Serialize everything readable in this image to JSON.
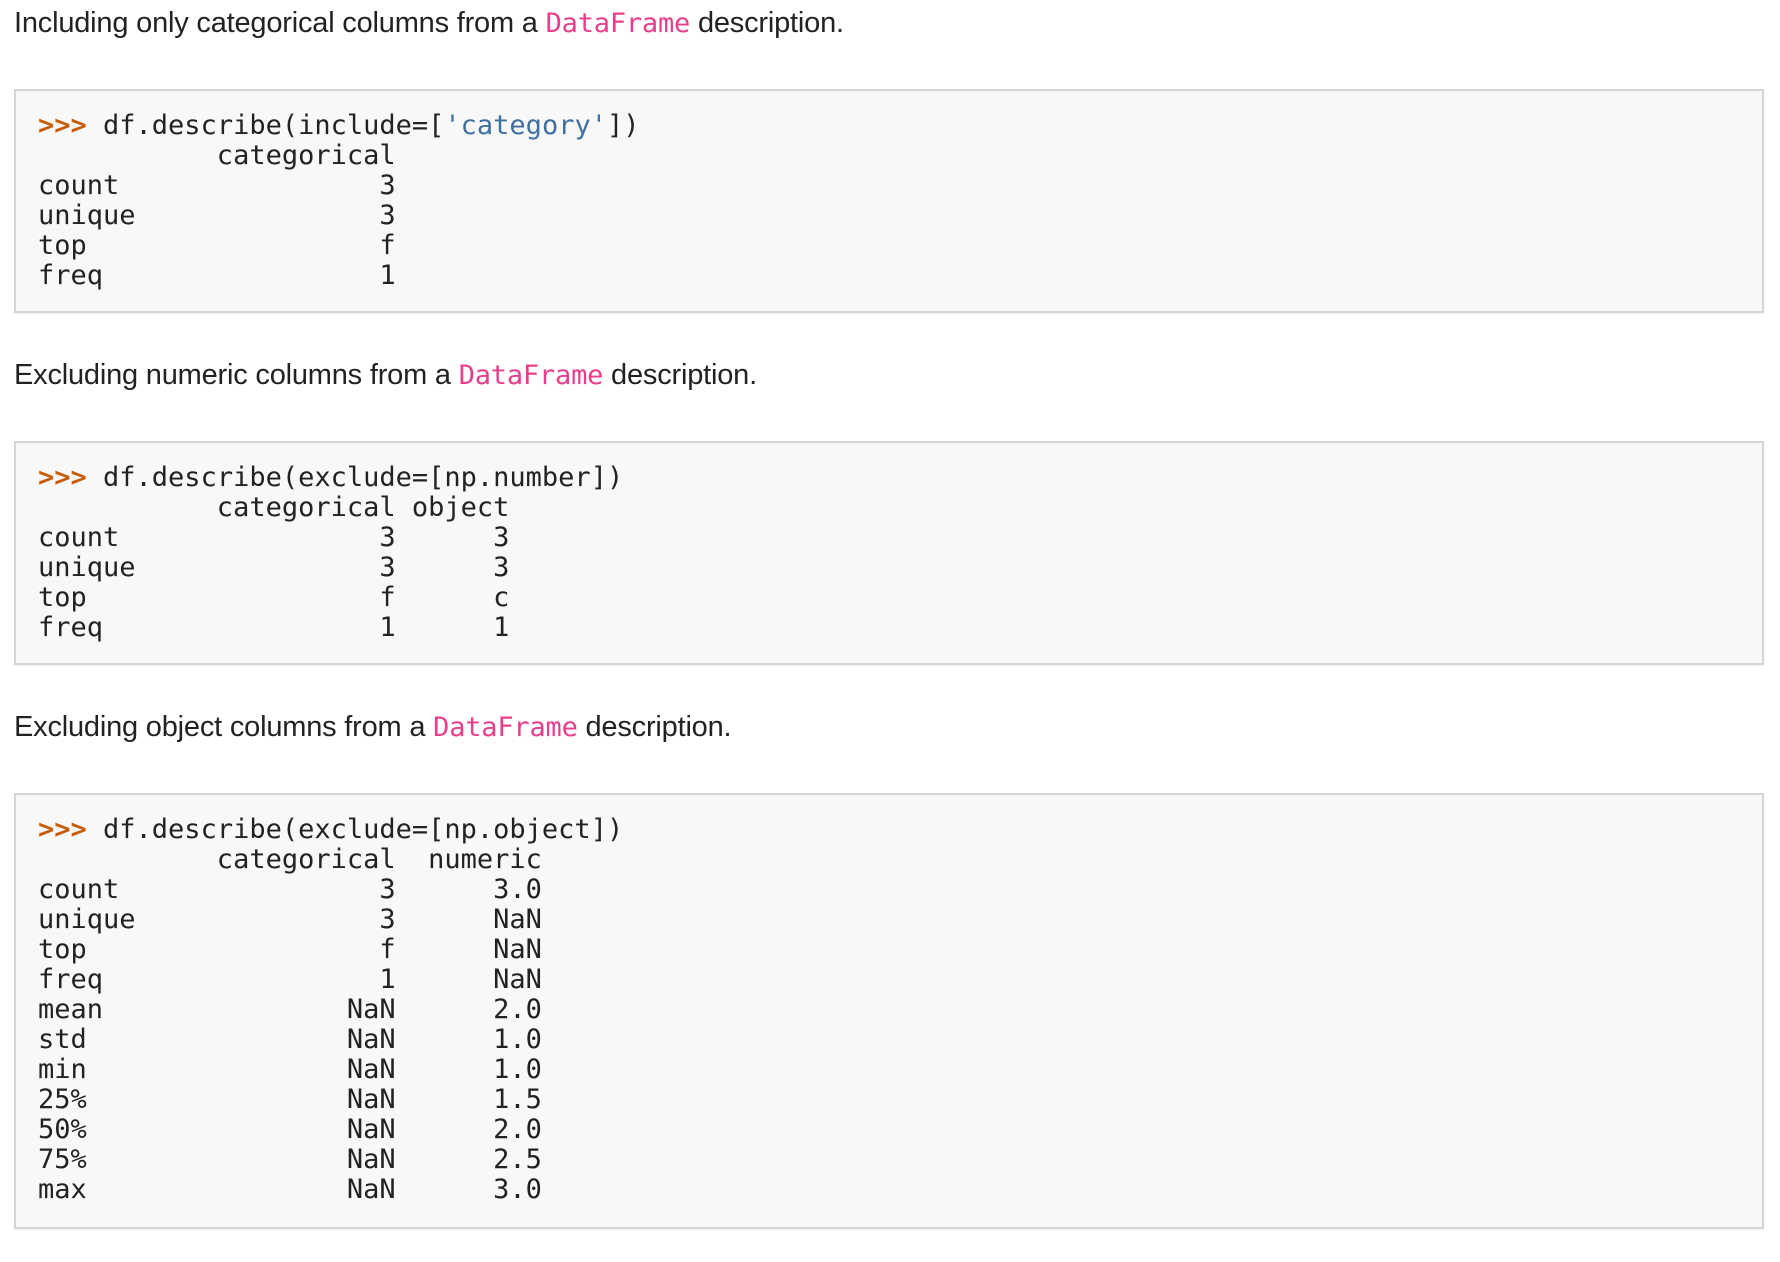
{
  "sections": [
    {
      "intro_before": "Including only categorical columns from a ",
      "intro_code": "DataFrame",
      "intro_after": " description.",
      "prompt": ">>> ",
      "command_before": "df.describe(include=[",
      "command_string": "'category'",
      "command_after": "])",
      "output": "           categorical\ncount                3\nunique               3\ntop                  f\nfreq                 1"
    },
    {
      "intro_before": "Excluding numeric columns from a ",
      "intro_code": "DataFrame",
      "intro_after": " description.",
      "prompt": ">>> ",
      "command": "df.describe(exclude=[np.number])",
      "output": "           categorical object\ncount                3      3\nunique               3      3\ntop                  f      c\nfreq                 1      1"
    },
    {
      "intro_before": "Excluding object columns from a ",
      "intro_code": "DataFrame",
      "intro_after": " description.",
      "prompt": ">>> ",
      "command": "df.describe(exclude=[np.object])",
      "output": "           categorical  numeric\ncount                3      3.0\nunique               3      NaN\ntop                  f      NaN\nfreq                 1      NaN\nmean               NaN      2.0\nstd                NaN      1.0\nmin                NaN      1.0\n25%                NaN      1.5\n50%                NaN      2.0\n75%                NaN      2.5\nmax                NaN      3.0"
    }
  ],
  "colors": {
    "inline_code": "#e83e8c",
    "prompt": "#c65d09",
    "string": "#4070a0",
    "code_background": "#f8f8f8",
    "code_border": "#d4d4d4"
  }
}
